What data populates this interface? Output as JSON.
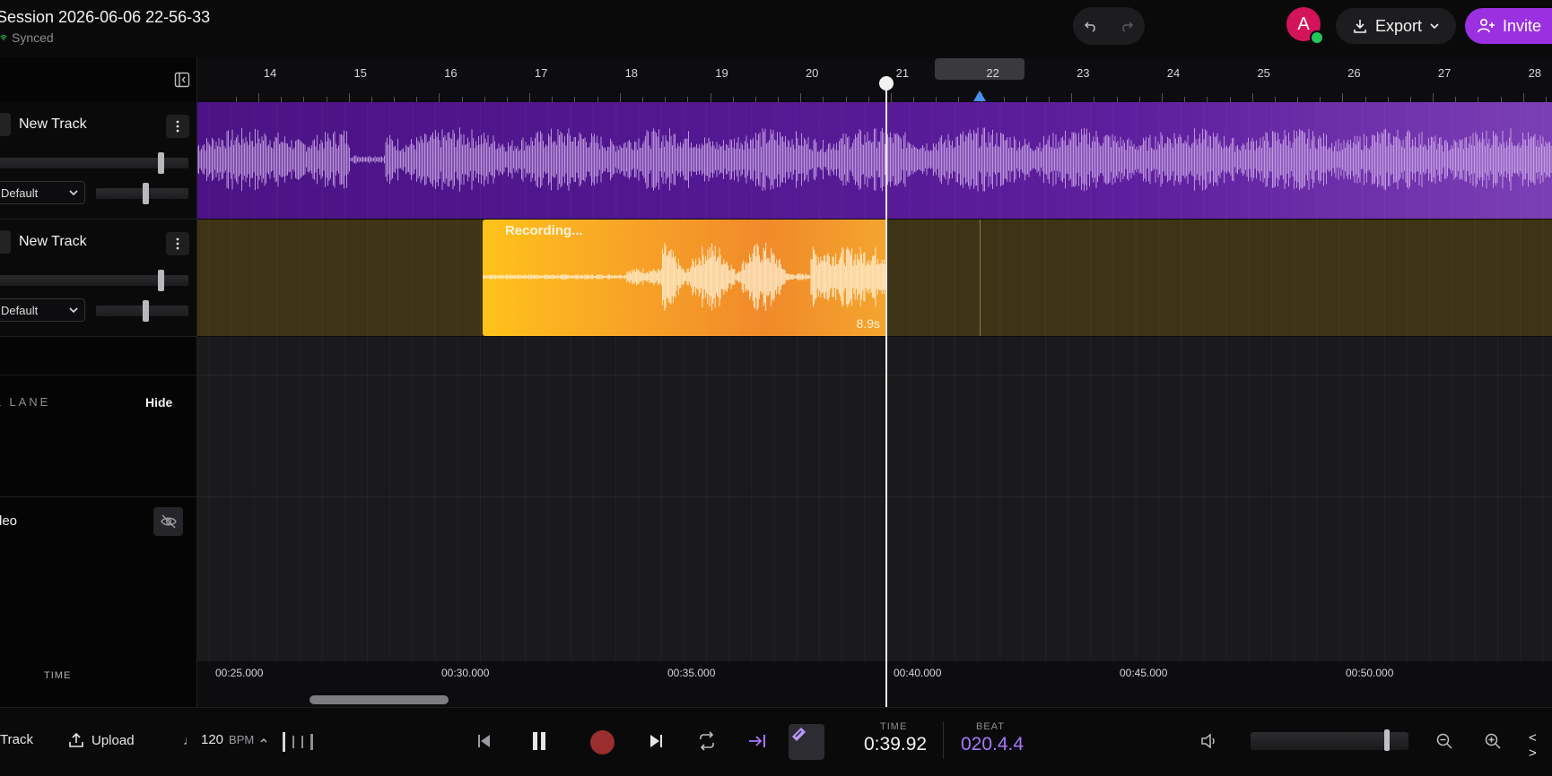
{
  "session": {
    "title": "Session 2026-06-06 22-56-33",
    "sync_status": "Synced"
  },
  "header": {
    "export_label": "Export",
    "invite_label": "Invite",
    "avatar_initial": "A"
  },
  "tracks": [
    {
      "name": "New Track",
      "preset": "Default"
    },
    {
      "name": "New Track",
      "preset": "Default"
    }
  ],
  "lanes": {
    "lane_label": "L LANE",
    "hide_label": "Hide",
    "video_label": "deo",
    "time_label": "TIME"
  },
  "ruler": {
    "marks": [
      "14",
      "15",
      "16",
      "17",
      "18",
      "19",
      "20",
      "21",
      "22",
      "23",
      "24",
      "25",
      "26",
      "27",
      "28"
    ]
  },
  "recording": {
    "label": "Recording...",
    "duration": "8.9s"
  },
  "time_axis": {
    "labels": [
      "00:25.000",
      "00:30.000",
      "00:35.000",
      "00:40.000",
      "00:45.000",
      "00:50.000"
    ]
  },
  "transport": {
    "add_track_label": "Track",
    "upload_label": "Upload",
    "bpm_value": "120",
    "bpm_unit": "BPM",
    "time_label": "TIME",
    "time_value": "0:39.92",
    "beat_label": "BEAT",
    "beat_value": "020.4.4",
    "nav_label": "< >"
  },
  "colors": {
    "accent": "#9b30e0",
    "track_a": "#531892",
    "track_b": "#3f3316",
    "clip": "#f9a826",
    "beat": "#a978ff",
    "record": "#9a2e2e"
  }
}
